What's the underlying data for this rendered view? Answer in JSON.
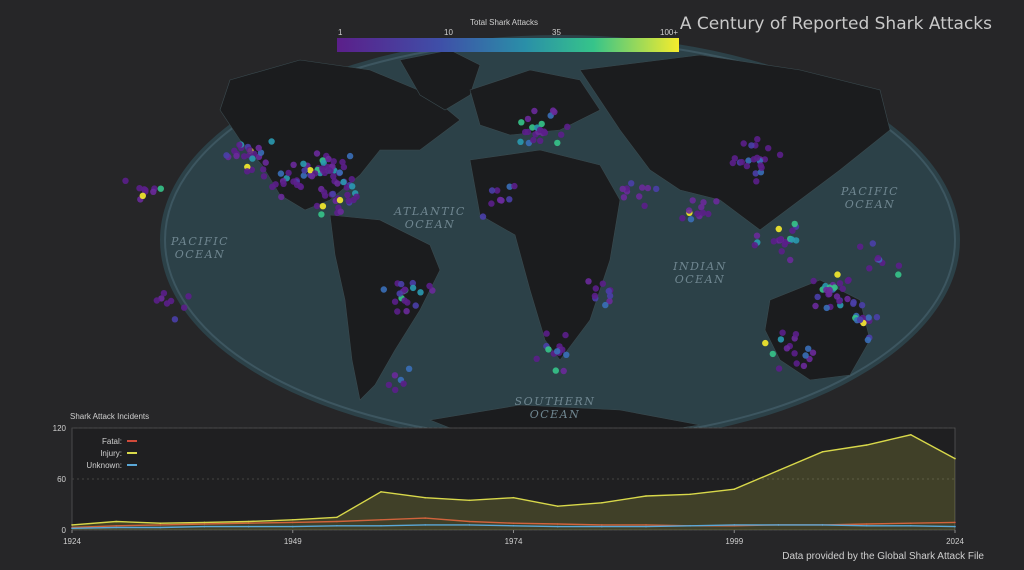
{
  "title": "A Century of Reported Shark Attacks",
  "legend": {
    "title": "Total Shark Attacks",
    "ticks": [
      "1",
      "10",
      "35",
      "100+"
    ],
    "colors": [
      "#5b1f8a",
      "#3f4fa8",
      "#2a8fa8",
      "#36c48a",
      "#f6ec2c"
    ]
  },
  "oceans": [
    {
      "label": "PACIFIC OCEAN",
      "lines": [
        "PACIFIC",
        "OCEAN"
      ]
    },
    {
      "label": "ATLANTIC OCEAN",
      "lines": [
        "ATLANTIC",
        "OCEAN"
      ]
    },
    {
      "label": "INDIAN OCEAN",
      "lines": [
        "INDIAN",
        "OCEAN"
      ]
    },
    {
      "label": "SOUTHERN OCEAN",
      "lines": [
        "SOUTHERN",
        "OCEAN"
      ]
    },
    {
      "label": "PACIFIC OCEAN",
      "lines": [
        "PACIFIC",
        "OCEAN"
      ]
    }
  ],
  "chart_title": "Shark Attack Incidents",
  "credit": "Data provided by the Global Shark Attack File",
  "chart_data": {
    "type": "area",
    "title": "Shark Attack Incidents",
    "x_ticks": [
      "1924",
      "1949",
      "1974",
      "1999",
      "2024"
    ],
    "y_ticks": [
      "0",
      "60",
      "120"
    ],
    "ylim": [
      0,
      120
    ],
    "xlim": [
      1924,
      2024
    ],
    "legend_position": "top-left",
    "x": [
      1924,
      1929,
      1934,
      1939,
      1944,
      1949,
      1954,
      1959,
      1964,
      1969,
      1974,
      1979,
      1984,
      1989,
      1994,
      1999,
      2004,
      2009,
      2014,
      2019,
      2024
    ],
    "series": [
      {
        "name": "Fatal:",
        "color": "#d04a3a",
        "values": [
          3,
          5,
          6,
          7,
          8,
          9,
          10,
          12,
          14,
          10,
          8,
          7,
          6,
          6,
          5,
          5,
          6,
          6,
          7,
          8,
          9
        ]
      },
      {
        "name": "Injury:",
        "color": "#d8d84a",
        "values": [
          6,
          10,
          8,
          9,
          10,
          12,
          15,
          45,
          38,
          35,
          38,
          28,
          32,
          40,
          42,
          48,
          70,
          92,
          100,
          112,
          84
        ]
      },
      {
        "name": "Unknown:",
        "color": "#5aa8d8",
        "values": [
          2,
          3,
          3,
          4,
          4,
          4,
          5,
          5,
          6,
          6,
          5,
          4,
          4,
          4,
          5,
          6,
          6,
          6,
          5,
          5,
          4
        ]
      }
    ]
  }
}
